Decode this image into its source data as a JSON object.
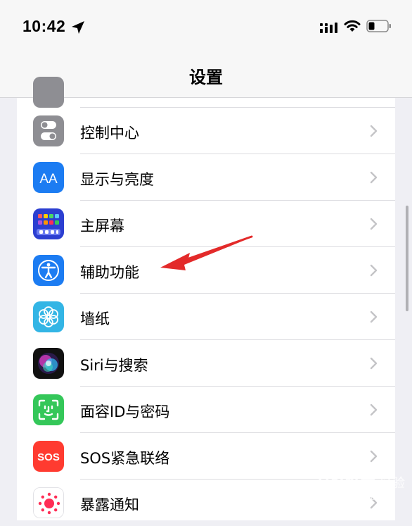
{
  "status": {
    "time": "10:42"
  },
  "nav": {
    "title": "设置"
  },
  "rows": [
    {
      "label": "控制中心",
      "icon": "control-center-icon",
      "color": "#8e8e93"
    },
    {
      "label": "显示与亮度",
      "icon": "display-brightness-icon",
      "color": "#1c7cf2"
    },
    {
      "label": "主屏幕",
      "icon": "home-screen-icon",
      "color": "#2c3fd1"
    },
    {
      "label": "辅助功能",
      "icon": "accessibility-icon",
      "color": "#1c7cf2"
    },
    {
      "label": "墙纸",
      "icon": "wallpaper-icon",
      "color": "#33b5e5"
    },
    {
      "label": "Siri与搜索",
      "icon": "siri-icon",
      "color": "#1a1a1a"
    },
    {
      "label": "面容ID与密码",
      "icon": "face-id-icon",
      "color": "#34c759"
    },
    {
      "label": "SOS紧急联络",
      "icon": "sos-icon",
      "color": "#ff3b30"
    },
    {
      "label": "暴露通知",
      "icon": "exposure-notification-icon",
      "color": "#ffffff"
    }
  ],
  "icon_text": {
    "aa": "AA",
    "sos": "SOS"
  },
  "watermark": {
    "brand": "Baidu",
    "sub": "经验",
    "site": "jingyan.baidu.com"
  }
}
